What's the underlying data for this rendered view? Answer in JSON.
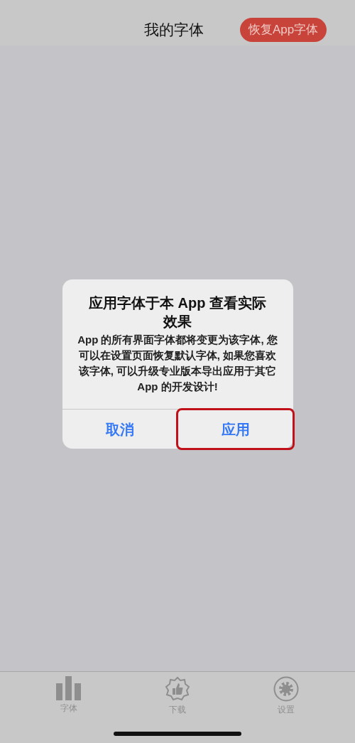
{
  "header": {
    "title": "我的字体",
    "action": "恢复App字体"
  },
  "dialog": {
    "title": "应用字体于本 App 查看实际效果",
    "message": "App 的所有界面字体都将变更为该字体, 您可以在设置页面恢复默认字体, 如果您喜欢该字体, 可以升级专业版本导出应用于其它 App 的开发设计!",
    "buttons": [
      {
        "label": "取消",
        "highlighted": false
      },
      {
        "label": "应用",
        "highlighted": true
      }
    ]
  },
  "tab_bar": [
    {
      "kind": "chart",
      "label": "字体"
    },
    {
      "kind": "badge",
      "label": "下载"
    },
    {
      "kind": "gear",
      "label": "设置"
    }
  ]
}
